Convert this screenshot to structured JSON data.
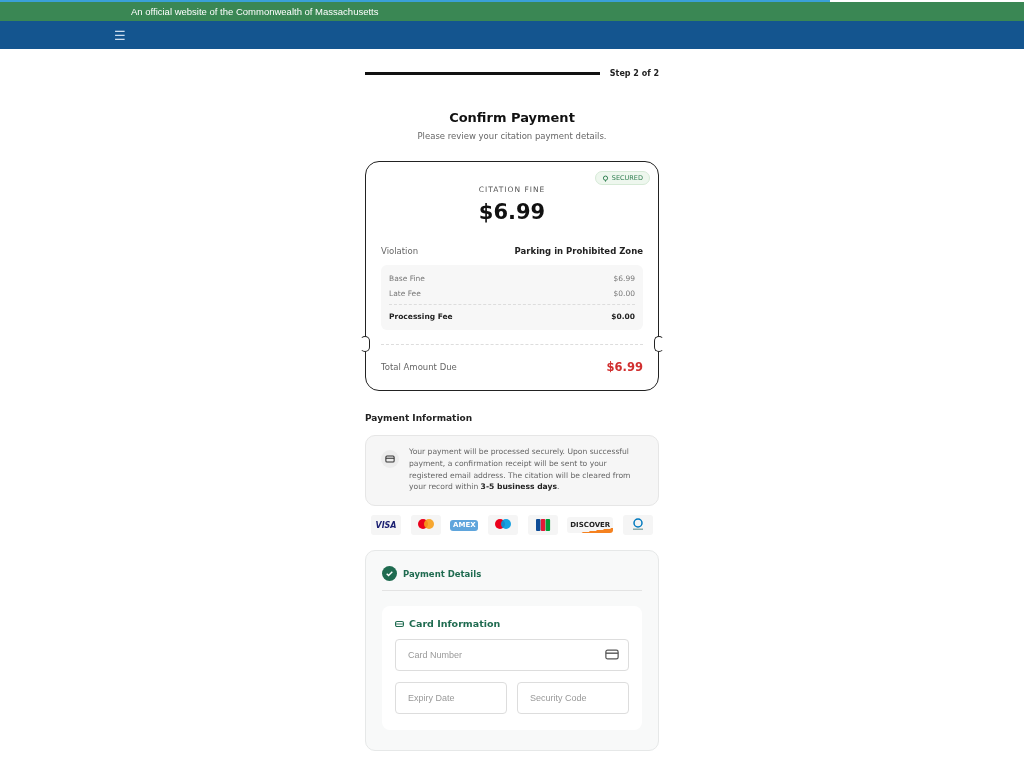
{
  "gov_banner": {
    "text": "An official website of the Commonwealth of Massachusetts"
  },
  "nav": {
    "menu_icon": "☰"
  },
  "progress": {
    "level": 1,
    "step": "Step 2 of 2"
  },
  "heading": {
    "title": "Confirm Payment",
    "subtitle": "Please review your citation payment details."
  },
  "citation_card": {
    "badge": "SECURED",
    "label": "CITATION FINE",
    "amount": "$6.99",
    "violation": {
      "label": "Violation",
      "value": "Parking in Prohibited Zone"
    },
    "fees": [
      {
        "label": "Base Fine",
        "value": "$6.99",
        "kind": "plain"
      },
      {
        "label": "Late Fee",
        "value": "$0.00",
        "kind": "plain"
      },
      {
        "label": "Processing Fee",
        "value": "$0.00",
        "kind": "strong"
      }
    ],
    "total": {
      "label": "Total Amount Due",
      "value": "$6.99"
    }
  },
  "payment_information": {
    "title": "Payment Information",
    "notice": "Your payment will be processed securely. Upon successful payment, a confirmation receipt will be sent to your registered email address. The citation will be cleared from your record within **3-5 business days**."
  },
  "card_brands": [
    {
      "kind": "visa",
      "text": "VISA"
    },
    {
      "kind": "mastercard"
    },
    {
      "kind": "amex",
      "text": "AMEX"
    },
    {
      "kind": "maestro"
    },
    {
      "kind": "jcb"
    },
    {
      "kind": "discover",
      "text": "DISCOVER"
    },
    {
      "kind": "diners"
    }
  ],
  "payment_details": {
    "title": "Payment Details",
    "section": "Card Information",
    "fields": [
      {
        "placeholder": "Card Number",
        "kind": "card"
      },
      {
        "placeholder": "Expiry Date",
        "kind": "half"
      },
      {
        "placeholder": "Security Code",
        "kind": "half"
      }
    ]
  }
}
